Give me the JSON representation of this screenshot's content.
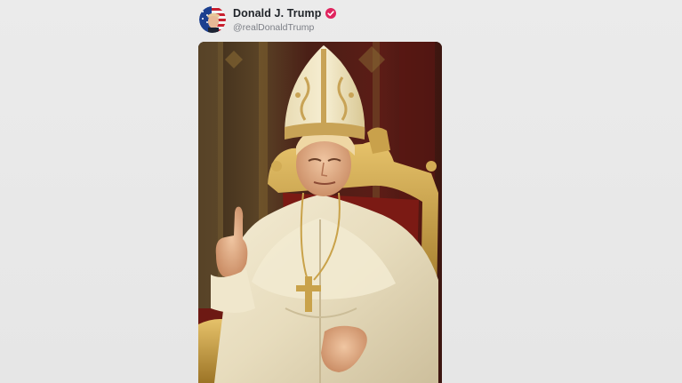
{
  "post": {
    "author": {
      "display_name": "Donald J. Trump",
      "handle": "@realDonaldTrump",
      "verified": true,
      "avatar_icon": "flag-avatar-icon",
      "verified_icon": "verified-badge-icon"
    },
    "image": {
      "subject": "figure in white papal vestments and gold-embroidered mitre, seated on a gilded red throne, right index finger raised"
    }
  },
  "colors": {
    "background": "#e8e8e8",
    "name_text": "#1f2328",
    "handle_text": "#7c7f86",
    "verified_badge": "#e0245e"
  }
}
